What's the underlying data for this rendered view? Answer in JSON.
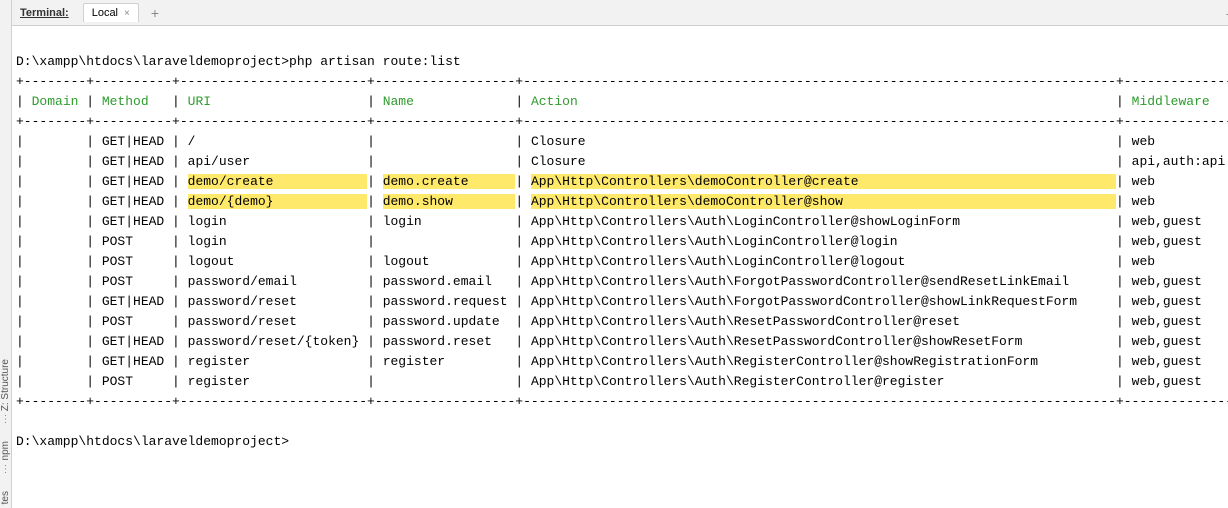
{
  "gutter": {
    "labels": [
      "Z: Structure",
      "npm",
      "tes"
    ]
  },
  "tabbar": {
    "title": "Terminal:",
    "tab_label": "Local",
    "close": "×",
    "add": "+",
    "minimize": "—",
    "gear": "✶"
  },
  "prompt": {
    "line1_path": "D:\\xampp\\htdocs\\laraveldemoproject>",
    "line1_cmd": "php artisan route:list",
    "line2_path": "D:\\xampp\\htdocs\\laraveldemoproject>"
  },
  "headers": {
    "domain": "Domain",
    "method": "Method",
    "uri": "URI",
    "name": "Name",
    "action": "Action",
    "middleware": "Middleware"
  },
  "widths": {
    "domain": 8,
    "method": 10,
    "uri": 24,
    "name": 18,
    "action": 76,
    "middleware": 14
  },
  "rows": [
    {
      "domain": "",
      "method": "GET|HEAD",
      "uri": "/",
      "name": "",
      "action": "Closure",
      "middleware": "web",
      "hl": false
    },
    {
      "domain": "",
      "method": "GET|HEAD",
      "uri": "api/user",
      "name": "",
      "action": "Closure",
      "middleware": "api,auth:api",
      "hl": false
    },
    {
      "domain": "",
      "method": "GET|HEAD",
      "uri": "demo/create",
      "name": "demo.create",
      "action": "App\\Http\\Controllers\\demoController@create",
      "middleware": "web",
      "hl": true
    },
    {
      "domain": "",
      "method": "GET|HEAD",
      "uri": "demo/{demo}",
      "name": "demo.show",
      "action": "App\\Http\\Controllers\\demoController@show",
      "middleware": "web",
      "hl": true
    },
    {
      "domain": "",
      "method": "GET|HEAD",
      "uri": "login",
      "name": "login",
      "action": "App\\Http\\Controllers\\Auth\\LoginController@showLoginForm",
      "middleware": "web,guest",
      "hl": false
    },
    {
      "domain": "",
      "method": "POST",
      "uri": "login",
      "name": "",
      "action": "App\\Http\\Controllers\\Auth\\LoginController@login",
      "middleware": "web,guest",
      "hl": false
    },
    {
      "domain": "",
      "method": "POST",
      "uri": "logout",
      "name": "logout",
      "action": "App\\Http\\Controllers\\Auth\\LoginController@logout",
      "middleware": "web",
      "hl": false
    },
    {
      "domain": "",
      "method": "POST",
      "uri": "password/email",
      "name": "password.email",
      "action": "App\\Http\\Controllers\\Auth\\ForgotPasswordController@sendResetLinkEmail",
      "middleware": "web,guest",
      "hl": false
    },
    {
      "domain": "",
      "method": "GET|HEAD",
      "uri": "password/reset",
      "name": "password.request",
      "action": "App\\Http\\Controllers\\Auth\\ForgotPasswordController@showLinkRequestForm",
      "middleware": "web,guest",
      "hl": false
    },
    {
      "domain": "",
      "method": "POST",
      "uri": "password/reset",
      "name": "password.update",
      "action": "App\\Http\\Controllers\\Auth\\ResetPasswordController@reset",
      "middleware": "web,guest",
      "hl": false
    },
    {
      "domain": "",
      "method": "GET|HEAD",
      "uri": "password/reset/{token}",
      "name": "password.reset",
      "action": "App\\Http\\Controllers\\Auth\\ResetPasswordController@showResetForm",
      "middleware": "web,guest",
      "hl": false
    },
    {
      "domain": "",
      "method": "GET|HEAD",
      "uri": "register",
      "name": "register",
      "action": "App\\Http\\Controllers\\Auth\\RegisterController@showRegistrationForm",
      "middleware": "web,guest",
      "hl": false
    },
    {
      "domain": "",
      "method": "POST",
      "uri": "register",
      "name": "",
      "action": "App\\Http\\Controllers\\Auth\\RegisterController@register",
      "middleware": "web,guest",
      "hl": false
    }
  ]
}
